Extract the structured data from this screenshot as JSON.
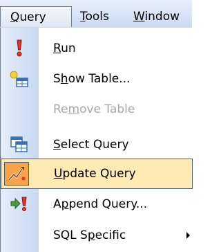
{
  "menubar": {
    "items": [
      {
        "label": "Query",
        "mnemonic": "Q",
        "rest": "uery",
        "active": true
      },
      {
        "label": "Tools",
        "mnemonic": "T",
        "rest": "ools"
      },
      {
        "label": "Window",
        "mnemonic": "W",
        "rest": "indow"
      }
    ]
  },
  "menu": {
    "items": [
      {
        "label": "Run",
        "mnemonic": "R",
        "rest": "un",
        "icon": "run-exclamation-icon",
        "disabled": false
      },
      {
        "label": "Show Table...",
        "pre": "S",
        "mnemonic": "h",
        "rest": "ow Table...",
        "icon": "show-table-icon",
        "disabled": false
      },
      {
        "label": "Remove Table",
        "pre": "Re",
        "mnemonic": "m",
        "rest": "ove Table",
        "icon": null,
        "disabled": true
      },
      {
        "label": "Select Query",
        "mnemonic": "S",
        "rest": "elect Query",
        "icon": "select-query-icon",
        "disabled": false
      },
      {
        "label": "Update Query",
        "mnemonic": "U",
        "rest": "pdate Query",
        "icon": "update-query-icon",
        "disabled": false,
        "highlighted": true
      },
      {
        "label": "Append Query...",
        "pre": "A",
        "mnemonic": "p",
        "rest": "pend Query...",
        "icon": "append-query-icon",
        "disabled": false
      },
      {
        "label": "SQL Specific",
        "pre": "SQL S",
        "mnemonic": "p",
        "rest": "ecific",
        "icon": null,
        "disabled": false,
        "submenu": true
      }
    ]
  },
  "colors": {
    "highlight_bg": "#ffe9b5",
    "highlight_icon_bg": "#f7a34a",
    "disabled_text": "#a7a7a7",
    "icon_column": "#c7d9f2"
  }
}
